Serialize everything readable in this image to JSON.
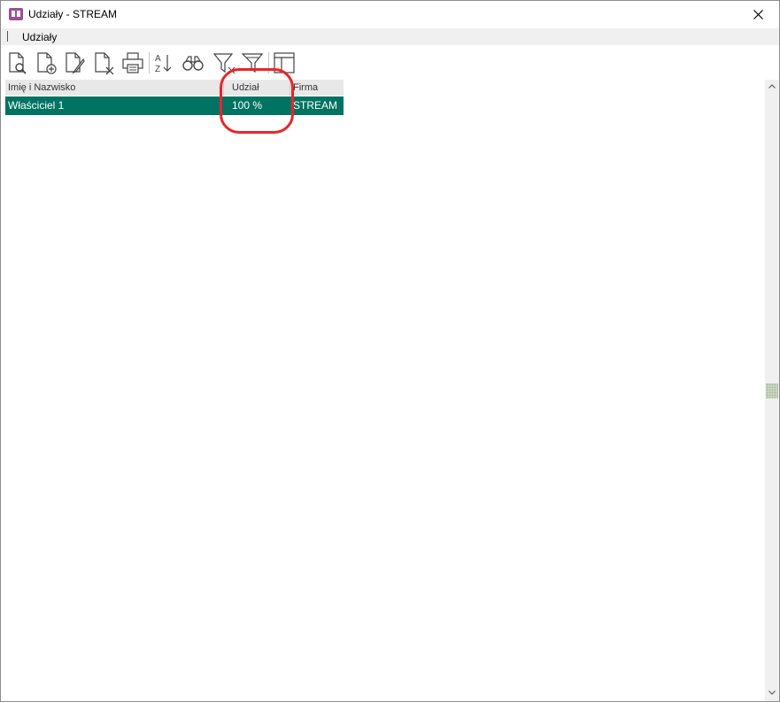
{
  "window": {
    "title": "Udziały - STREAM",
    "icon": "book-icon",
    "close_icon": "close-icon"
  },
  "menu": {
    "items": [
      "Udziały"
    ]
  },
  "toolbar": {
    "buttons": [
      {
        "name": "preview-document-icon"
      },
      {
        "name": "add-document-icon"
      },
      {
        "name": "edit-document-icon"
      },
      {
        "name": "delete-document-icon"
      },
      {
        "name": "printer-icon"
      },
      {
        "name": "sort-az-icon"
      },
      {
        "name": "binoculars-icon"
      },
      {
        "name": "filter-icon"
      },
      {
        "name": "clear-filter-icon"
      },
      {
        "name": "columns-layout-icon"
      }
    ]
  },
  "grid": {
    "columns": [
      "Imię i Nazwisko",
      "Udział",
      "Firma"
    ],
    "rows": [
      [
        "Właściciel 1",
        "100 %",
        "STREAM"
      ]
    ],
    "selected_row_color": "#007362",
    "annotation_color": "#e8262a"
  }
}
